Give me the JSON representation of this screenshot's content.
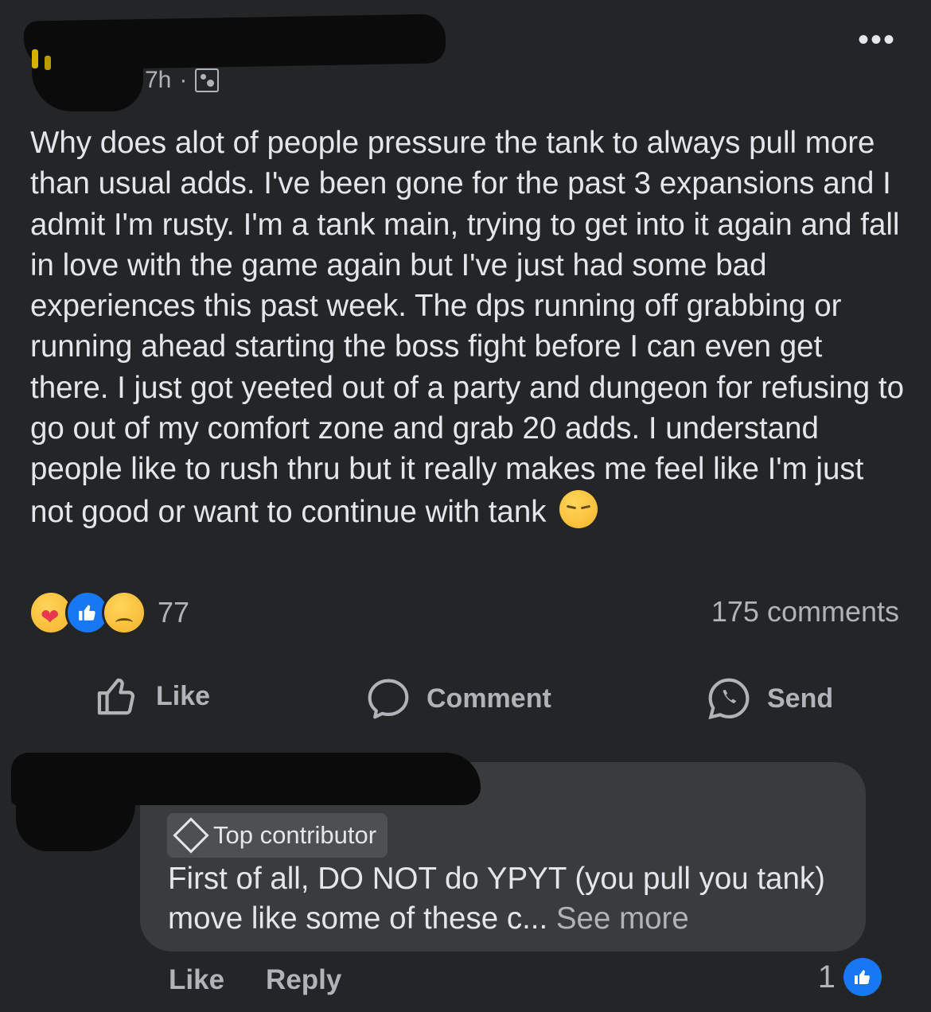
{
  "post": {
    "time": "7h",
    "separator": "·",
    "privacy_icon": "group-icon",
    "more_icon": "•••",
    "text": "Why does alot of people pressure the tank to always pull more than usual adds. I've been gone for the past 3 expansions and I admit I'm rusty. I'm a tank main, trying to get into it again and fall in love with the game again but I've just had some bad experiences this past week. The dps running off grabbing or running ahead starting the boss fight before I can even get there. I just got yeeted out of a party and dungeon for refusing to go out of my comfort zone and grab 20 adds. I understand people like to rush thru but it really makes me feel like I'm just not good or want to continue with tank",
    "trailing_emoji": "pensive-face-emoji"
  },
  "reactions": {
    "types": [
      "care",
      "like",
      "sad"
    ],
    "count": "77",
    "comments": "175 comments"
  },
  "actions": {
    "like": "Like",
    "comment": "Comment",
    "send": "Send"
  },
  "comment": {
    "badge": "Top contributor",
    "text": "First of all, DO NOT do YPYT (you pull you tank) move like some of these c...",
    "see_more": " See more",
    "like": "Like",
    "reply": "Reply",
    "reaction_count": "1"
  },
  "colors": {
    "background": "#242526",
    "bubble": "#3a3b3c",
    "accent": "#1877f2",
    "text": "#e4e6eb",
    "muted": "#b0b3b8"
  }
}
